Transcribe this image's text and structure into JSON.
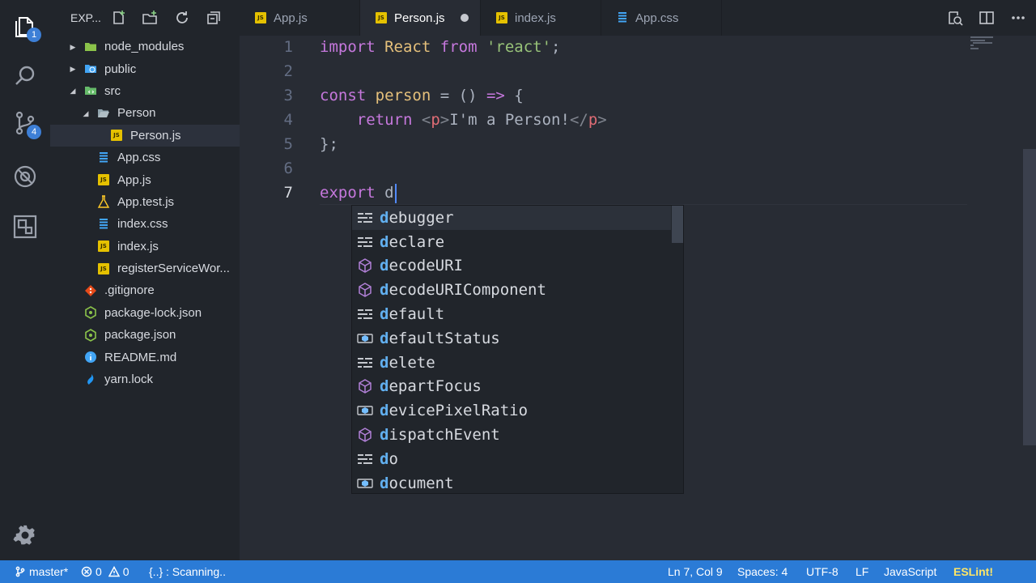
{
  "activity_bar": {
    "explorer_badge": "1",
    "scm_badge": "4"
  },
  "sidebar": {
    "title": "EXP..."
  },
  "tree": [
    {
      "label": "node_modules",
      "indent": 0,
      "twisty": "closed",
      "icon": "folder-icon"
    },
    {
      "label": "public",
      "indent": 0,
      "twisty": "closed",
      "icon": "folder-globe-icon"
    },
    {
      "label": "src",
      "indent": 0,
      "twisty": "open",
      "icon": "folder-src-icon"
    },
    {
      "label": "Person",
      "indent": 1,
      "twisty": "open",
      "icon": "folder-open-icon"
    },
    {
      "label": "Person.js",
      "indent": 2,
      "twisty": "none",
      "icon": "js-file-icon",
      "selected": true
    },
    {
      "label": "App.css",
      "indent": 1,
      "twisty": "none",
      "icon": "css-file-icon"
    },
    {
      "label": "App.js",
      "indent": 1,
      "twisty": "none",
      "icon": "js-file-icon"
    },
    {
      "label": "App.test.js",
      "indent": 1,
      "twisty": "none",
      "icon": "test-file-icon"
    },
    {
      "label": "index.css",
      "indent": 1,
      "twisty": "none",
      "icon": "css-file-icon"
    },
    {
      "label": "index.js",
      "indent": 1,
      "twisty": "none",
      "icon": "js-file-icon"
    },
    {
      "label": "registerServiceWor...",
      "indent": 1,
      "twisty": "none",
      "icon": "js-file-icon"
    },
    {
      "label": ".gitignore",
      "indent": 0,
      "twisty": "none",
      "icon": "git-file-icon"
    },
    {
      "label": "package-lock.json",
      "indent": 0,
      "twisty": "none",
      "icon": "npm-file-icon"
    },
    {
      "label": "package.json",
      "indent": 0,
      "twisty": "none",
      "icon": "npm-file-icon"
    },
    {
      "label": "README.md",
      "indent": 0,
      "twisty": "none",
      "icon": "info-file-icon"
    },
    {
      "label": "yarn.lock",
      "indent": 0,
      "twisty": "none",
      "icon": "yarn-file-icon"
    }
  ],
  "tabs": [
    {
      "label": "App.js",
      "icon": "js-file-icon",
      "active": false,
      "dirty": false
    },
    {
      "label": "Person.js",
      "icon": "js-file-icon",
      "active": true,
      "dirty": true
    },
    {
      "label": "index.js",
      "icon": "js-file-icon",
      "active": false,
      "dirty": false
    },
    {
      "label": "App.css",
      "icon": "css-file-icon",
      "active": false,
      "dirty": false
    }
  ],
  "editor": {
    "current_line": 7,
    "lines": [
      {
        "n": "1",
        "tokens": [
          [
            "k",
            "import"
          ],
          [
            "p",
            " "
          ],
          [
            "v",
            "React"
          ],
          [
            "p",
            " "
          ],
          [
            "k",
            "from"
          ],
          [
            "p",
            " "
          ],
          [
            "s",
            "'react'"
          ],
          [
            "p",
            ";"
          ]
        ]
      },
      {
        "n": "2",
        "tokens": []
      },
      {
        "n": "3",
        "tokens": [
          [
            "k",
            "const"
          ],
          [
            "p",
            " "
          ],
          [
            "v",
            "person"
          ],
          [
            "p",
            " = () "
          ],
          [
            "k",
            "=>"
          ],
          [
            "p",
            " {"
          ]
        ]
      },
      {
        "n": "4",
        "tokens": [
          [
            "p",
            "    "
          ],
          [
            "k",
            "return"
          ],
          [
            "p",
            " "
          ],
          [
            "tagp",
            "<"
          ],
          [
            "t",
            "p"
          ],
          [
            "tagp",
            ">"
          ],
          [
            "p",
            "I'm a Person!"
          ],
          [
            "tagp",
            "</"
          ],
          [
            "t",
            "p"
          ],
          [
            "tagp",
            ">"
          ]
        ]
      },
      {
        "n": "5",
        "tokens": [
          [
            "p",
            "};"
          ]
        ]
      },
      {
        "n": "6",
        "tokens": []
      },
      {
        "n": "7",
        "tokens": [
          [
            "k",
            "export"
          ],
          [
            "p",
            " d"
          ]
        ]
      }
    ]
  },
  "suggestions": {
    "prefix": "d",
    "items": [
      {
        "label": "debugger",
        "kind": "keyword-icon",
        "focused": true
      },
      {
        "label": "declare",
        "kind": "keyword-icon"
      },
      {
        "label": "decodeURI",
        "kind": "method-icon"
      },
      {
        "label": "decodeURIComponent",
        "kind": "method-icon"
      },
      {
        "label": "default",
        "kind": "keyword-icon"
      },
      {
        "label": "defaultStatus",
        "kind": "variable-icon"
      },
      {
        "label": "delete",
        "kind": "keyword-icon"
      },
      {
        "label": "departFocus",
        "kind": "method-icon"
      },
      {
        "label": "devicePixelRatio",
        "kind": "variable-icon"
      },
      {
        "label": "dispatchEvent",
        "kind": "method-icon"
      },
      {
        "label": "do",
        "kind": "keyword-icon"
      },
      {
        "label": "document",
        "kind": "variable-icon"
      }
    ]
  },
  "statusbar": {
    "branch": "master*",
    "errors": "0",
    "warnings": "0",
    "task": "{..} : Scanning..",
    "position": "Ln 7, Col 9",
    "spaces": "Spaces: 4",
    "encoding": "UTF-8",
    "eol": "LF",
    "language": "JavaScript",
    "linter": "ESLint!"
  },
  "colors": {
    "accent": "#2b7bd6",
    "keyword": "#c678dd",
    "string": "#98c379",
    "variable": "#e5c07b",
    "match": "#61afef"
  }
}
